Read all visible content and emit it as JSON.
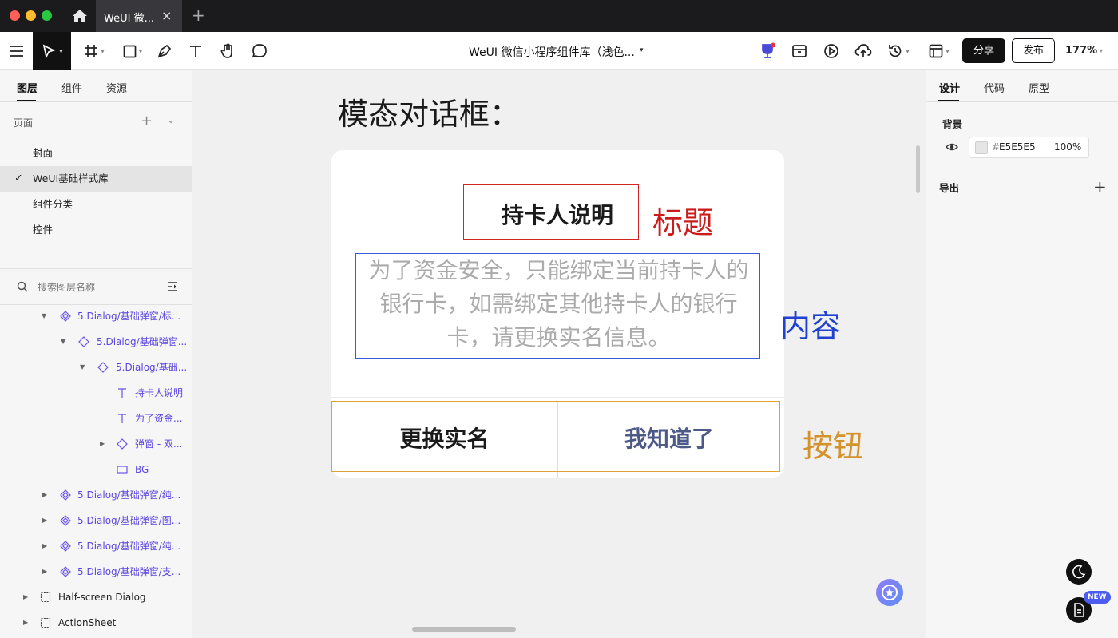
{
  "window": {
    "tab_title": "WeUI 微...",
    "tab_close": "×",
    "new_tab": "+"
  },
  "toolbar": {
    "doc_title": "WeUI 微信小程序组件库（浅色...",
    "doc_caret": "▾",
    "share_label": "分享",
    "publish_label": "发布",
    "zoom": "177%",
    "tool_caret": "▾"
  },
  "left_panel": {
    "tabs": [
      "图层",
      "组件",
      "资源"
    ],
    "pages_header": "页面",
    "pages_add": "+",
    "pages_toggle": "⌄",
    "pages": [
      {
        "label": "封面"
      },
      {
        "label": "WeUI基础样式库",
        "check": "✓"
      },
      {
        "label": "组件分类"
      },
      {
        "label": "控件"
      }
    ],
    "search_placeholder": "搜索图层名称",
    "layers": [
      {
        "arrow": "▼",
        "name": "5.Dialog/基础弹窗/标..."
      },
      {
        "arrow": "▼",
        "name": "5.Dialog/基础弹窗..."
      },
      {
        "arrow": "▼",
        "name": "5.Dialog/基础..."
      },
      {
        "arrow": "",
        "name": "持卡人说明"
      },
      {
        "arrow": "",
        "name": "为了资金..."
      },
      {
        "arrow": "▶",
        "name": "弹窗 - 双..."
      },
      {
        "arrow": "",
        "name": "BG"
      },
      {
        "arrow": "▶",
        "name": "5.Dialog/基础弹窗/纯..."
      },
      {
        "arrow": "▶",
        "name": "5.Dialog/基础弹窗/图..."
      },
      {
        "arrow": "▶",
        "name": "5.Dialog/基础弹窗/纯..."
      },
      {
        "arrow": "▶",
        "name": "5.Dialog/基础弹窗/支..."
      },
      {
        "arrow": "▶",
        "name": "Half-screen Dialog"
      },
      {
        "arrow": "▶",
        "name": "ActionSheet"
      }
    ]
  },
  "canvas": {
    "heading": "模态对话框：",
    "dialog_title": "持卡人说明",
    "dialog_content": "为了资金安全，只能绑定当前持卡人的银行卡，如需绑定其他持卡人的银行卡，请更换实名信息。",
    "btn_secondary": "更换实名",
    "btn_primary": "我知道了",
    "annotation_title": "标题",
    "annotation_content": "内容",
    "annotation_buttons": "按钮"
  },
  "right_panel": {
    "tabs": [
      "设计",
      "代码",
      "原型"
    ],
    "background_label": "背景",
    "color_hash": "#",
    "color_hex": "E5E5E5",
    "opacity": "100%",
    "export_label": "导出",
    "export_add": "+",
    "new_badge": "NEW"
  },
  "colors": {
    "title_annotation": "#cc1b1b",
    "content_annotation": "#2040d0",
    "button_annotation": "#d4922a",
    "primary_button_text": "#4d5a87",
    "background_swatch": "#E5E5E5"
  }
}
